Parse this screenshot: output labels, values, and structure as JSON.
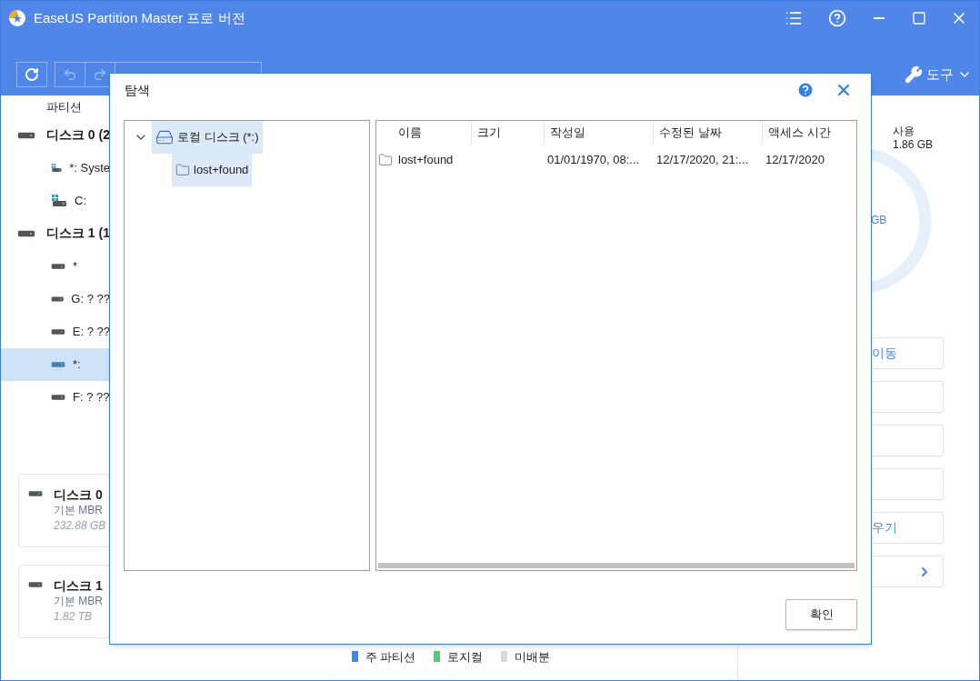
{
  "window": {
    "title": "EaseUS Partition Master 프로 버전"
  },
  "toolbar": {
    "tools_label": "도구"
  },
  "sidebar": {
    "heading": "파티션",
    "items": [
      {
        "kind": "disk",
        "label": "디스크 0 (2",
        "selected": false
      },
      {
        "kind": "system-partition",
        "label": "*: Syste",
        "selected": false
      },
      {
        "kind": "system-partition",
        "label": "C:",
        "selected": false
      },
      {
        "kind": "disk",
        "label": "디스크 1 (1",
        "selected": false
      },
      {
        "kind": "partition",
        "label": "*",
        "selected": false
      },
      {
        "kind": "partition",
        "label": "G: ? ??",
        "selected": false
      },
      {
        "kind": "partition",
        "label": "E: ? ??",
        "selected": false
      },
      {
        "kind": "partition",
        "label": "*:",
        "selected": true
      },
      {
        "kind": "partition",
        "label": "F: ? ??",
        "selected": false
      }
    ],
    "disk_cards": [
      {
        "name": "디스크 0",
        "type": "기본 MBR",
        "size": "232.88 GB"
      },
      {
        "name": "디스크 1",
        "type": "기본 MBR",
        "size": "1.82 TB"
      }
    ]
  },
  "details": {
    "used_label": "사용",
    "used_value": "1.86 GB",
    "ring_label": "GB",
    "actions": [
      {
        "label": "이동",
        "kind": "text"
      },
      {
        "kind": "blank"
      },
      {
        "kind": "blank"
      },
      {
        "kind": "blank"
      },
      {
        "label": "우기",
        "kind": "text"
      },
      {
        "kind": "more"
      }
    ]
  },
  "legend": [
    {
      "label": "주 파티션",
      "color": "#3b86f0"
    },
    {
      "label": "로지컬",
      "color": "#4fcf7a"
    },
    {
      "label": "미배분",
      "color": "#d8d8d8"
    }
  ],
  "dialog": {
    "title": "탐색",
    "tree": [
      {
        "label": "로컬 디스크 (*:)",
        "expanded": true,
        "selected": true,
        "children": [
          {
            "label": "lost+found",
            "selected": true
          }
        ]
      }
    ],
    "columns": [
      "이름",
      "크기",
      "작성일",
      "수정된 날짜",
      "액세스 시간"
    ],
    "rows": [
      {
        "cells": [
          "lost+found",
          "",
          "01/01/1970, 08:...",
          "12/17/2020, 21:...",
          "12/17/2020"
        ]
      }
    ],
    "ok_button": "확인"
  }
}
